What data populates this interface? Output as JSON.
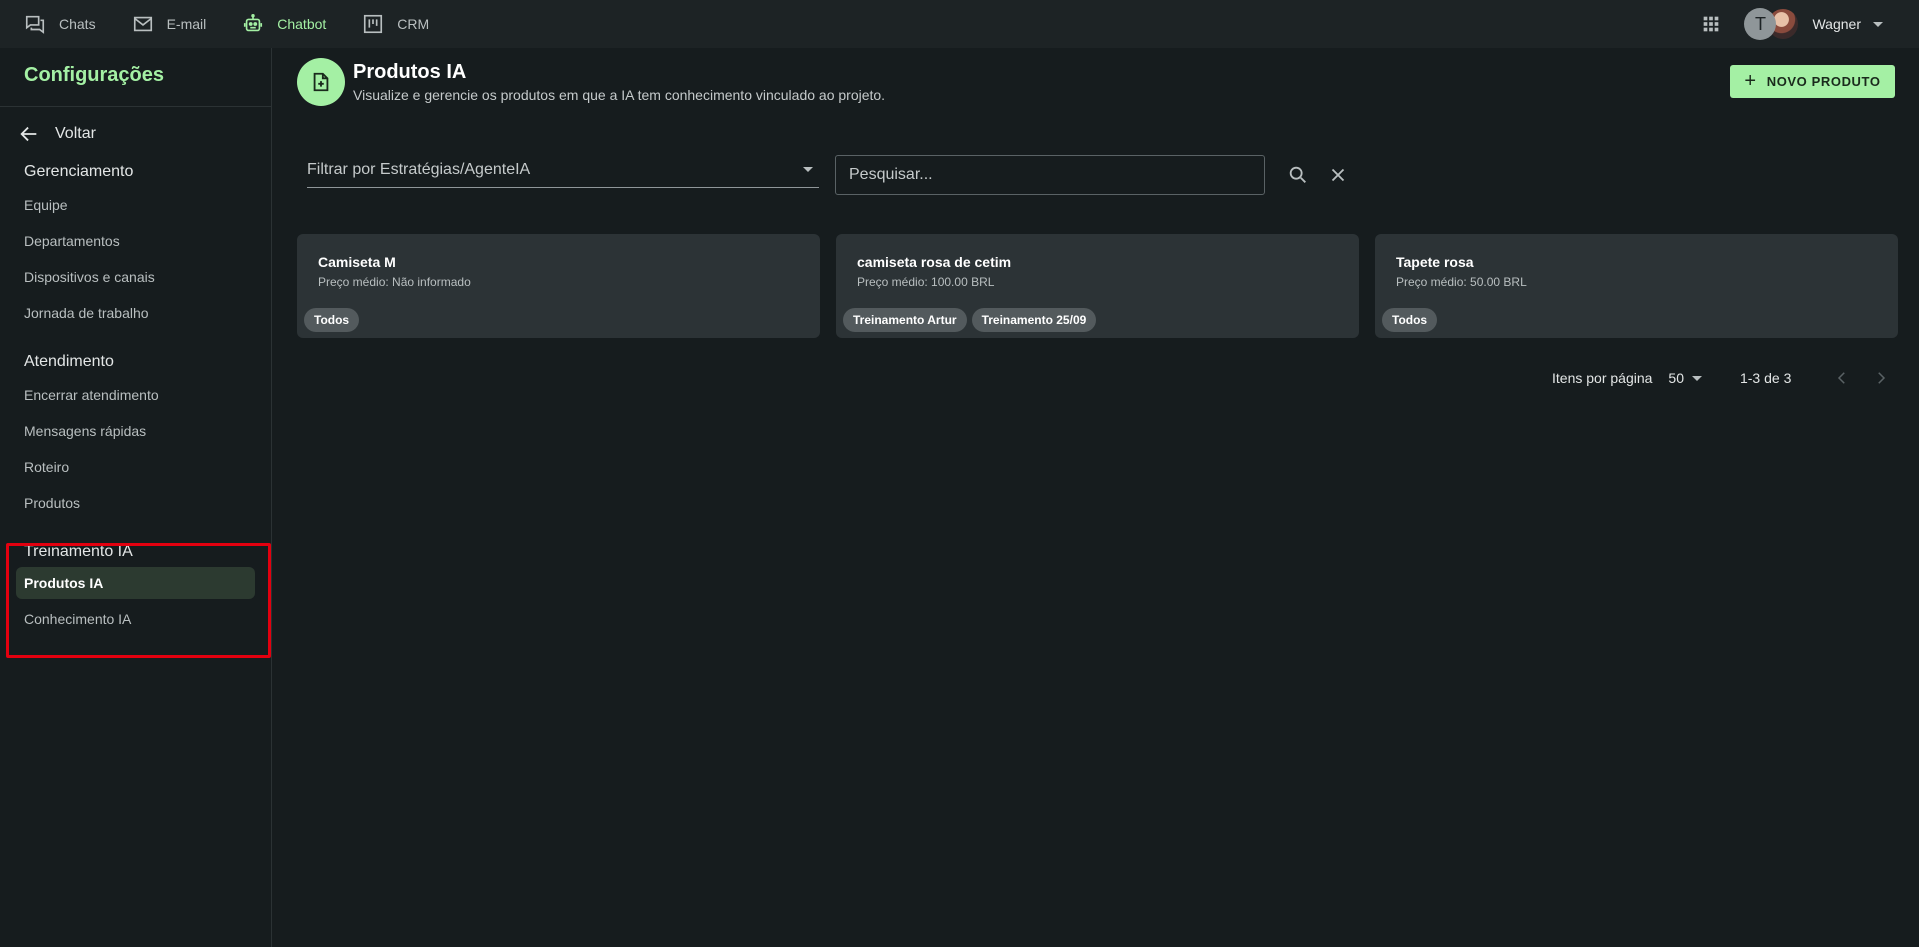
{
  "topbar": {
    "nav": [
      {
        "label": "Chats",
        "icon": "chat-icon",
        "active": false
      },
      {
        "label": "E-mail",
        "icon": "mail-icon",
        "active": false
      },
      {
        "label": "Chatbot",
        "icon": "robot-icon",
        "active": true
      },
      {
        "label": "CRM",
        "icon": "kanban-icon",
        "active": false
      }
    ],
    "apps_icon": "apps-grid-icon",
    "avatar_initial": "T",
    "user_name": "Wagner"
  },
  "sidebar": {
    "title": "Configurações",
    "back_label": "Voltar",
    "sections": [
      {
        "title": "Gerenciamento",
        "items": [
          "Equipe",
          "Departamentos",
          "Dispositivos e canais",
          "Jornada de trabalho"
        ]
      },
      {
        "title": "Atendimento",
        "items": [
          "Encerrar atendimento",
          "Mensagens rápidas",
          "Roteiro",
          "Produtos"
        ]
      },
      {
        "title": "Treinamento IA",
        "items": [
          "Produtos IA",
          "Conhecimento IA"
        ]
      }
    ],
    "active_item": "Produtos IA"
  },
  "header": {
    "title": "Produtos IA",
    "subtitle": "Visualize e gerencie os produtos em que a IA tem conhecimento vinculado ao projeto.",
    "new_button": "NOVO PRODUTO"
  },
  "filters": {
    "select_label": "Filtrar por Estratégias/AgenteIA",
    "search_placeholder": "Pesquisar..."
  },
  "products": [
    {
      "name": "Camiseta M",
      "price": "Preço médio: Não informado",
      "tags": [
        "Todos"
      ]
    },
    {
      "name": "camiseta rosa de cetim",
      "price": "Preço médio: 100.00 BRL",
      "tags": [
        "Treinamento Artur",
        "Treinamento 25/09"
      ]
    },
    {
      "name": "Tapete rosa",
      "price": "Preço médio: 50.00 BRL",
      "tags": [
        "Todos"
      ]
    }
  ],
  "pagination": {
    "per_page_label": "Itens por página",
    "per_page_value": "50",
    "range": "1-3 de 3"
  },
  "colors": {
    "accent": "#a4f0a4",
    "background": "#161c1e",
    "card": "#2c3336",
    "highlight": "#e3000f"
  }
}
